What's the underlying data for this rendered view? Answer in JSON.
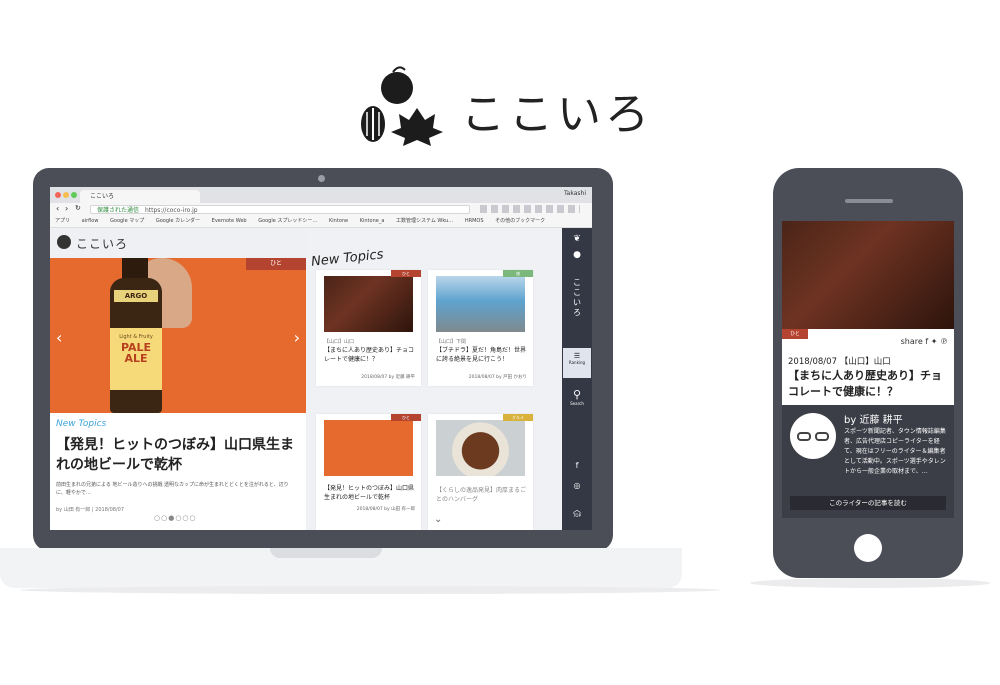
{
  "brand": {
    "name": "ここいろ"
  },
  "laptop_browser": {
    "tab_title": "ここいろ",
    "user_name": "Takashi",
    "url_secure_label": "保護された通信",
    "url": "https://coco-iro.jp",
    "bookmarks": [
      "アプリ",
      "airflow",
      "Google マップ",
      "Google カレンダー",
      "Evernote Web",
      "Google スプレッドシー…",
      "Kintone",
      "Kintone_a",
      "工数管理システム Wku…",
      "HRMOS",
      "その他のブックマーク"
    ]
  },
  "site": {
    "logo": "ここいろ",
    "hero": {
      "category": "ひと",
      "section_label": "New Topics",
      "title": "【発見！ヒットのつぼみ】山口県生まれの地ビールで乾杯",
      "description": "前田生まれの兄弟による 地ビール造りへの挑戦 透明なカップに命が生まれとどくとを注がれると、辺りに、軽やかで…",
      "byline": "by 山田 有一郎 | 2018/08/07",
      "bottle_label_top": "Light & Fruity",
      "bottle_label_main": "PALE ALE",
      "bottle_brand": "ARGO"
    },
    "topics_heading": "New Topics",
    "cards": [
      {
        "tag": "ひと",
        "tag_color": "#b4442f",
        "category": "【山口】山口",
        "title": "【まちに人あり歴史あり】チョコレートで健康に！？",
        "by": "2018/08/07 by 近藤 耕平"
      },
      {
        "tag": "旅",
        "tag_color": "#7cb87c",
        "category": "【山口】下関",
        "title": "【ブチドラ】夏だ！角島だ！世界に誇る絶景を見に行こう！",
        "by": "2018/08/07 by 戸田 かおり"
      },
      {
        "tag": "ひと",
        "tag_color": "#b4442f",
        "category": "",
        "title": "【発見！ヒットのつぼみ】山口県生まれの地ビールで乾杯",
        "by": "2018/08/07 by 山田 有一郎"
      },
      {
        "tag": "グルメ",
        "tag_color": "#d8b23a",
        "category": "",
        "title": "【くらしの逸品発見】肉厚まるごとのハンバーグ",
        "by": ""
      }
    ],
    "rail": {
      "vertical_logo": "ここいろ",
      "ranking_label": "Ranking",
      "search_label": "Search",
      "top_label": "TOP"
    }
  },
  "phone": {
    "tag": "ひと",
    "share_label": "share",
    "date_place": "2018/08/07 【山口】山口",
    "title": "【まちに人あり歴史あり】チョコレートで健康に！？",
    "author_by": "by 近藤 耕平",
    "author_bio": "スポーツ新聞記者、タウン情報誌編集者、広告代理店コピーライターを経て、現在はフリーのライター＆編集者として活動中。スポーツ選手やタレントから一般企業の取材まで、…",
    "author_button": "このライターの記事を読む"
  }
}
